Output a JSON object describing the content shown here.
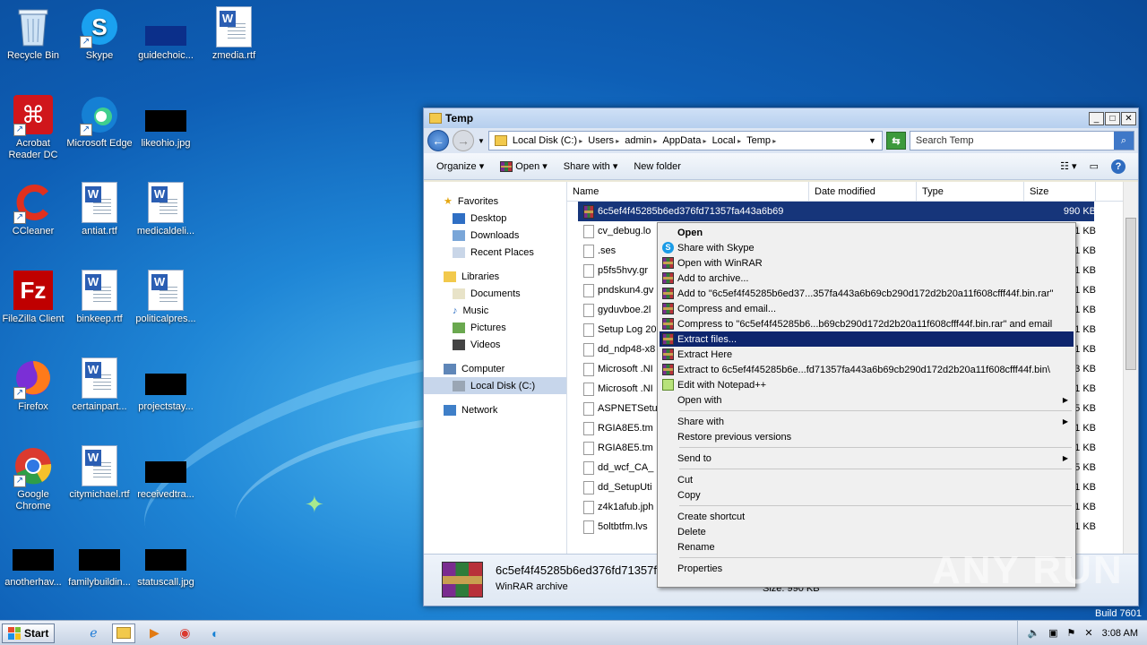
{
  "desktop": {
    "icons": [
      {
        "label": "Recycle Bin"
      },
      {
        "label": "Skype"
      },
      {
        "label": "guidechoic..."
      },
      {
        "label": "zmedia.rtf"
      },
      {
        "label": "Acrobat Reader DC"
      },
      {
        "label": "Microsoft Edge"
      },
      {
        "label": "likeohio.jpg"
      },
      {
        "label": "CCleaner"
      },
      {
        "label": "antiat.rtf"
      },
      {
        "label": "medicaldeli..."
      },
      {
        "label": "FileZilla Client"
      },
      {
        "label": "binkeep.rtf"
      },
      {
        "label": "politicalpres..."
      },
      {
        "label": "Firefox"
      },
      {
        "label": "certainpart..."
      },
      {
        "label": "projectstay..."
      },
      {
        "label": "Google Chrome"
      },
      {
        "label": "citymichael.rtf"
      },
      {
        "label": "receivedtra..."
      },
      {
        "label": "anotherhav..."
      },
      {
        "label": "familybuildin..."
      },
      {
        "label": "statuscall.jpg"
      }
    ]
  },
  "window": {
    "title": "Temp",
    "address": [
      "Local Disk (C:)",
      "Users",
      "admin",
      "AppData",
      "Local",
      "Temp"
    ],
    "search_placeholder": "Search Temp",
    "toolbar": {
      "organize": "Organize",
      "open": "Open",
      "share_with": "Share with",
      "new_folder": "New folder"
    },
    "nav": {
      "favorites": "Favorites",
      "desktop": "Desktop",
      "downloads": "Downloads",
      "recent": "Recent Places",
      "libraries": "Libraries",
      "documents": "Documents",
      "music": "Music",
      "pictures": "Pictures",
      "videos": "Videos",
      "computer": "Computer",
      "local_disk": "Local Disk (C:)",
      "network": "Network"
    },
    "columns": {
      "name": "Name",
      "date": "Date modified",
      "type": "Type",
      "size": "Size"
    },
    "files": [
      {
        "name": "6c5ef4f45285b6ed376fd71357fa443a6b69",
        "size": "990 KB"
      },
      {
        "name": "cv_debug.lo",
        "size": "1 KB"
      },
      {
        "name": ".ses",
        "size": "1 KB"
      },
      {
        "name": "p5fs5hvy.gr",
        "size": "1 KB"
      },
      {
        "name": "pndskun4.gv",
        "size": "1 KB"
      },
      {
        "name": "gyduvboe.2l",
        "size": "1 KB"
      },
      {
        "name": "Setup Log 20",
        "size": "1 KB"
      },
      {
        "name": "dd_ndp48-x8",
        "size": "1 KB"
      },
      {
        "name": "Microsoft .NI",
        "size": "3 KB"
      },
      {
        "name": "Microsoft .NI",
        "size": "1 KB"
      },
      {
        "name": "ASPNETSetu",
        "size": "5 KB"
      },
      {
        "name": "RGIA8E5.tm",
        "size": "1 KB"
      },
      {
        "name": "RGIA8E5.tm",
        "size": "1 KB"
      },
      {
        "name": "dd_wcf_CA_",
        "size": "5 KB"
      },
      {
        "name": "dd_SetupUti",
        "size": "1 KB"
      },
      {
        "name": "z4k1afub.jph",
        "size": "1 KB"
      },
      {
        "name": "5oltbtfm.lvs",
        "size": "1 KB"
      }
    ],
    "details": {
      "name": "6c5ef4f45285b6ed376fd71357fa",
      "type": "WinRAR archive",
      "size": "Size: 990 KB"
    }
  },
  "context_menu": {
    "items": [
      {
        "label": "Open"
      },
      {
        "label": "Share with Skype"
      },
      {
        "label": "Open with WinRAR"
      },
      {
        "label": "Add to archive..."
      },
      {
        "label": "Add to \"6c5ef4f45285b6ed37...357fa443a6b69cb290d172d2b20a11f608cfff44f.bin.rar\""
      },
      {
        "label": "Compress and email..."
      },
      {
        "label": "Compress to \"6c5ef4f45285b6...b69cb290d172d2b20a11f608cfff44f.bin.rar\" and email"
      },
      {
        "label": "Extract files..."
      },
      {
        "label": "Extract Here"
      },
      {
        "label": "Extract to 6c5ef4f45285b6e...fd71357fa443a6b69cb290d172d2b20a11f608cfff44f.bin\\"
      },
      {
        "label": "Edit with Notepad++"
      },
      {
        "label": "Open with"
      },
      {
        "label": "Share with"
      },
      {
        "label": "Restore previous versions"
      },
      {
        "label": "Send to"
      },
      {
        "label": "Cut"
      },
      {
        "label": "Copy"
      },
      {
        "label": "Create shortcut"
      },
      {
        "label": "Delete"
      },
      {
        "label": "Rename"
      },
      {
        "label": "Properties"
      }
    ]
  },
  "taskbar": {
    "start": "Start",
    "clock": "3:08 AM"
  },
  "watermark": "ANY RUN",
  "build": "Build 7601"
}
